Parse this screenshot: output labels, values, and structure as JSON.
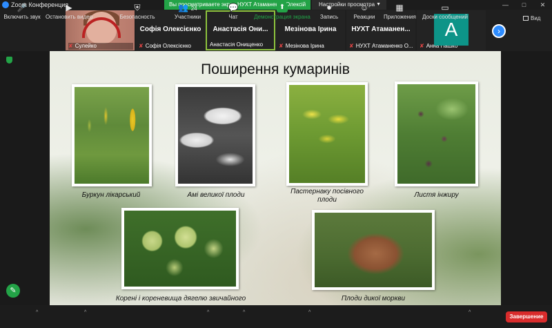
{
  "window": {
    "title": "Zoom Конференция",
    "share_banner": "Вы просматриваете экран НУХТ Атаманенко Олексій",
    "view_options": "Настройки просмотра",
    "controls": [
      "—",
      "□",
      "✕"
    ]
  },
  "participants": [
    {
      "name": "",
      "footer": "Сулейко",
      "muted": true,
      "kind": "video"
    },
    {
      "name": "Софія Олексієнко",
      "footer": "Софія Олексієнко",
      "muted": true,
      "kind": "name"
    },
    {
      "name": "Анастасія Они...",
      "footer": "Анастасія Онищенко",
      "muted": false,
      "kind": "name",
      "active": true
    },
    {
      "name": "Мезінова Ірина",
      "footer": "Мезінова Ірина",
      "muted": true,
      "kind": "name"
    },
    {
      "name": "НУХТ Атаманен...",
      "footer": "НУХТ Атаманенко О...",
      "muted": true,
      "kind": "name"
    },
    {
      "name": "",
      "avatar_letter": "А",
      "footer": "Анна Пашко",
      "muted": true,
      "kind": "avatar"
    }
  ],
  "strip": {
    "next_icon": "›",
    "view_label": "Вид"
  },
  "slide": {
    "title": "Поширення кумаринів",
    "images": [
      {
        "name": "clover-photo",
        "caption": "Буркун лікарський"
      },
      {
        "name": "ammi-photo",
        "caption": "Амі великої плоди"
      },
      {
        "name": "parsnip-photo",
        "caption": "Пастернаку посівного плоди"
      },
      {
        "name": "fig-photo",
        "caption": "Листя інжиру"
      },
      {
        "name": "angelica-photo",
        "caption": "Корені і кореневища дягелю звичайного"
      },
      {
        "name": "carrot-photo",
        "caption": "Плоди дикої моркви"
      }
    ]
  },
  "toolbar": {
    "unmute": "Включить звук",
    "stop_video": "Остановить видео",
    "security": "Безопасность",
    "participants": "Участники",
    "participants_count": "24",
    "chat": "Чат",
    "share": "Демонстрация экрана",
    "record": "Запись",
    "reactions": "Реакции",
    "apps": "Приложения",
    "whiteboards": "Доски сообщений",
    "end": "Завершение"
  },
  "icons": {
    "mic": "🎤",
    "video": "▶",
    "shield": "⛨",
    "people": "👥",
    "chat": "💬",
    "share": "⬆",
    "record": "⏺",
    "reaction": "☺",
    "apps": "▦",
    "board": "▭",
    "pen": "✎"
  },
  "colors": {
    "accent": "#2d8cff",
    "share_green": "#23a347",
    "end_red": "#d92c2c",
    "avatar_teal": "#0d9488"
  }
}
